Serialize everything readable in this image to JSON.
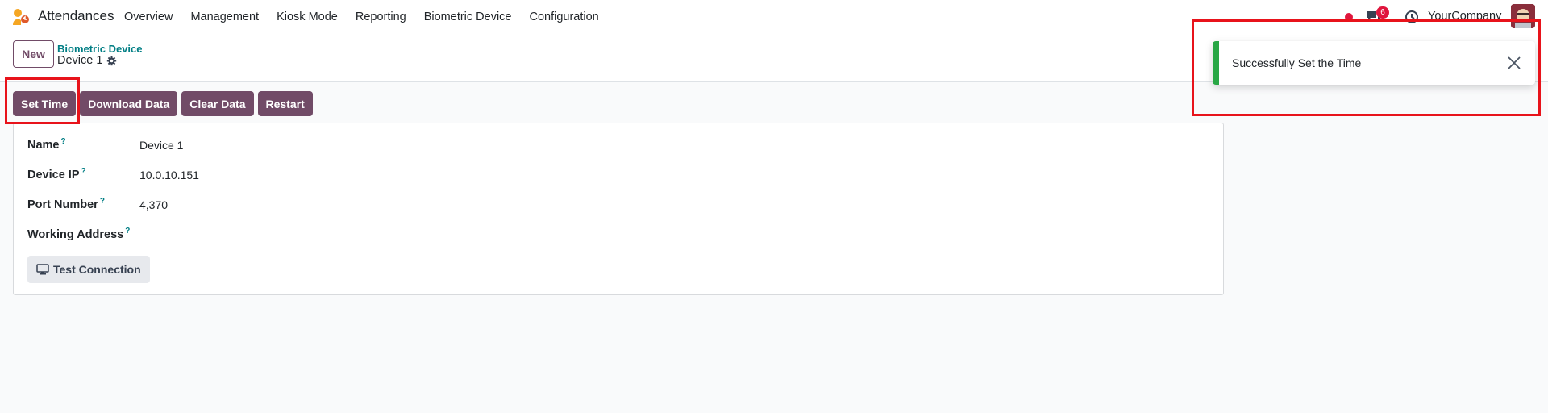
{
  "navbar": {
    "app_name": "Attendances",
    "menu": [
      "Overview",
      "Management",
      "Kiosk Mode",
      "Reporting",
      "Biometric Device",
      "Configuration"
    ],
    "chat_badge": "6",
    "company": "YourCompany",
    "icons": [
      "attendances-app-icon",
      "activity-dot-icon",
      "chat-icon",
      "clock-icon",
      "avatar"
    ]
  },
  "control_panel": {
    "new_label": "New",
    "breadcrumb": "Biometric Device",
    "record_title": "Device 1"
  },
  "actions": {
    "set_time": "Set Time",
    "download_data": "Download Data",
    "clear_data": "Clear Data",
    "restart": "Restart"
  },
  "form": {
    "fields": [
      {
        "label": "Name",
        "help": "?",
        "value": "Device 1"
      },
      {
        "label": "Device IP",
        "help": "?",
        "value": "10.0.10.151"
      },
      {
        "label": "Port Number",
        "help": "?",
        "value": "4,370"
      },
      {
        "label": "Working Address",
        "help": "?",
        "value": ""
      }
    ],
    "test_connection": "Test Connection"
  },
  "notification": {
    "message": "Successfully Set the Time",
    "accent_color": "#28a745"
  },
  "colors": {
    "primary": "#714b67",
    "link": "#017e84",
    "highlight": "#e8131b"
  }
}
